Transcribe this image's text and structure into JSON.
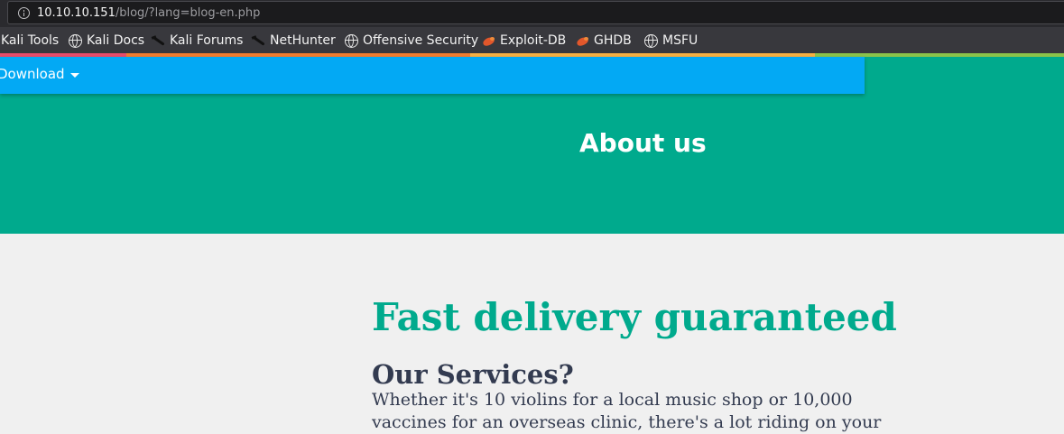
{
  "browser": {
    "url_host": "10.10.10.151",
    "url_path": "/blog/?lang=blog-en.php",
    "bookmarks": [
      {
        "label": "Kali Tools",
        "icon": "none"
      },
      {
        "label": "Kali Docs",
        "icon": "globe-icon"
      },
      {
        "label": "Kali Forums",
        "icon": "kali-dragon-icon"
      },
      {
        "label": "NetHunter",
        "icon": "kali-dragon-icon"
      },
      {
        "label": "Offensive Security",
        "icon": "globe-icon"
      },
      {
        "label": "Exploit-DB",
        "icon": "exploit-db-bug-icon"
      },
      {
        "label": "GHDB",
        "icon": "exploit-db-bug-icon"
      },
      {
        "label": "MSFU",
        "icon": "globe-icon"
      }
    ],
    "colorline": [
      "#e94c6a",
      "#f17d2e",
      "#f7b042",
      "#8bc34a"
    ]
  },
  "page": {
    "nav": {
      "download_label": "Download"
    },
    "hero": {
      "title": "About us"
    },
    "main": {
      "heading": "Fast delivery guaranteed",
      "services_heading": "Our Services?",
      "services_text": "Whether it's 10 violins for a local music shop or 10,000 vaccines for an overseas clinic, there's a lot riding on your"
    },
    "colors": {
      "hero": "#00aa8d",
      "navbar": "#03a9f4",
      "heading": "#00aa8d",
      "text": "#333b50",
      "background": "#f0f0f0"
    }
  }
}
